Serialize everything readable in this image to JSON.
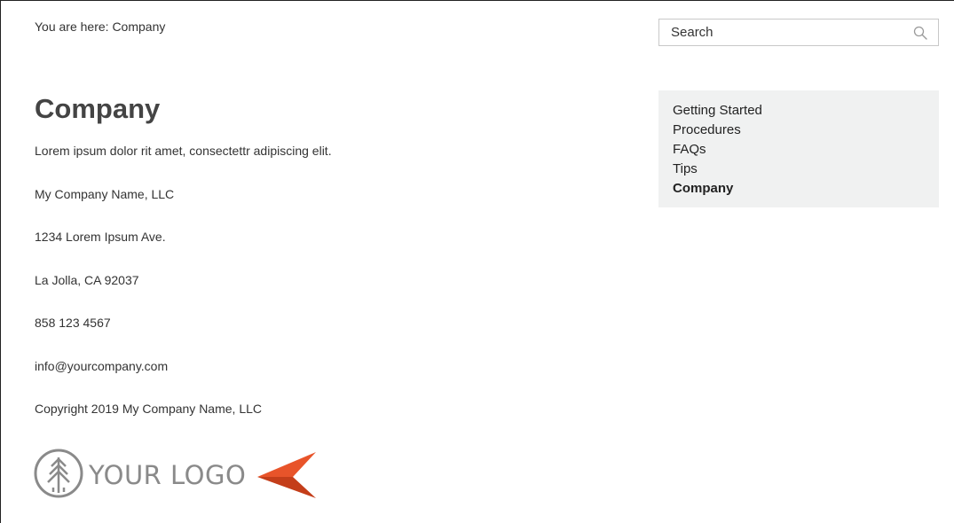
{
  "breadcrumb": {
    "text": "You are here: Company"
  },
  "search": {
    "placeholder": "Search",
    "icon": "magnifier-icon"
  },
  "main": {
    "title": "Company",
    "paragraphs": [
      "Lorem ipsum dolor rit amet, consectettr adipiscing elit.",
      "My Company Name, LLC",
      "1234 Lorem Ipsum Ave.",
      "La Jolla, CA 92037",
      "858 123 4567",
      "info@yourcompany.com",
      "Copyright 2019 My Company Name, LLC"
    ]
  },
  "logo": {
    "text": "YOUR LOGO",
    "colors": {
      "gray": "#8a8a8a",
      "accent": "#e8542a",
      "accent_dark": "#c43e1a"
    }
  },
  "sidenav": {
    "items": [
      {
        "label": "Getting Started",
        "active": false
      },
      {
        "label": "Procedures",
        "active": false
      },
      {
        "label": "FAQs",
        "active": false
      },
      {
        "label": "Tips",
        "active": false
      },
      {
        "label": "Company",
        "active": true
      }
    ]
  },
  "colors": {
    "sidenav_bg": "#f0f1f1",
    "text": "#333333",
    "title": "#444444"
  }
}
